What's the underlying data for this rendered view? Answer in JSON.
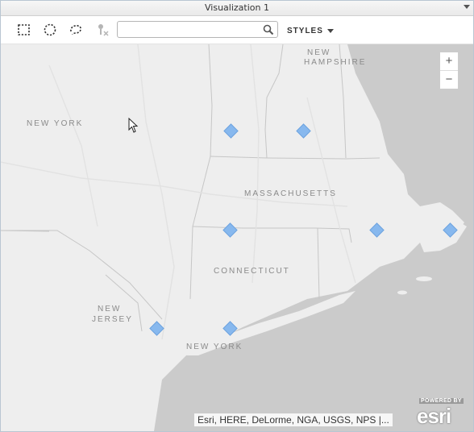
{
  "window": {
    "title": "Visualization 1"
  },
  "toolbar": {
    "search": {
      "value": "",
      "placeholder": ""
    },
    "styles_label": "STYLES"
  },
  "map": {
    "labels": {
      "new_hampshire_1": "NEW",
      "new_hampshire_2": "HAMPSHIRE",
      "new_york_state": "NEW YORK",
      "massachusetts": "MASSACHUSETTS",
      "connecticut": "CONNECTICUT",
      "new_jersey_1": "NEW",
      "new_jersey_2": "JERSEY",
      "new_york_long_island": "NEW YORK"
    },
    "zoom": {
      "in_label": "+",
      "out_label": "−"
    },
    "attribution": "Esri, HERE, DeLorme, NGA, USGS, NPS |...",
    "logo": {
      "powered_by": "POWERED BY",
      "brand": "esri"
    },
    "marker_color": "#87b8ee"
  }
}
